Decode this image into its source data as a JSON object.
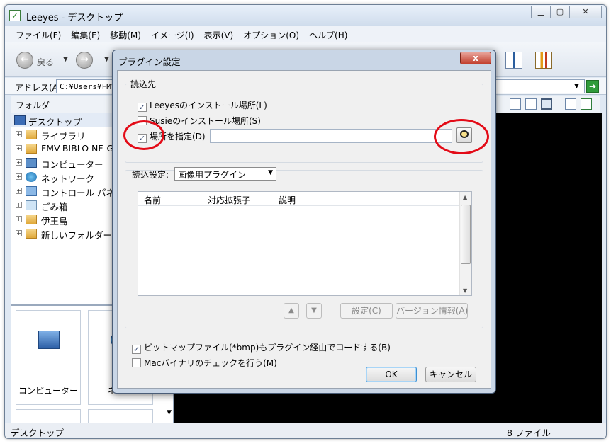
{
  "window": {
    "title": "Leeyes - デスクトップ",
    "menu": [
      "ファイル(F)",
      "編集(E)",
      "移動(M)",
      "イメージ(I)",
      "表示(V)",
      "オプション(O)",
      "ヘルプ(H)"
    ],
    "toolbar": {
      "back_label": "戻る"
    },
    "address": {
      "label": "アドレス(A)",
      "value": "C:¥Users¥FMV"
    },
    "folder_pane": {
      "header": "フォルダ",
      "items": [
        {
          "label": "デスクトップ",
          "icon": "desktop-icon"
        },
        {
          "label": "ライブラリ",
          "icon": "library-icon"
        },
        {
          "label": "FMV-BIBLO NF-G",
          "icon": "user-folder-icon"
        },
        {
          "label": "コンピューター",
          "icon": "computer-icon"
        },
        {
          "label": "ネットワーク",
          "icon": "network-icon"
        },
        {
          "label": "コントロール パネ",
          "icon": "control-panel-icon"
        },
        {
          "label": "ごみ箱",
          "icon": "recycle-bin-icon"
        },
        {
          "label": "伊王島",
          "icon": "folder-icon"
        },
        {
          "label": "新しいフォルダー",
          "icon": "folder-icon"
        }
      ]
    },
    "thumbnails": [
      {
        "label": "コンピューター"
      },
      {
        "label": "ネット"
      }
    ],
    "status": {
      "left": "デスクトップ",
      "right": "8 ファイル"
    }
  },
  "dialog": {
    "title": "プラグイン設定",
    "close_label": "x",
    "group_read_location": "読込先",
    "opt_install_location": "Leeyesのインストール場所(L)",
    "opt_susie_location": "Susieのインストール場所(S)",
    "opt_specify_location": "場所を指定(D)",
    "path_value": "",
    "read_settings_label": "読込設定:",
    "read_settings_value": "画像用プラグイン",
    "columns": [
      "名前",
      "対応拡張子",
      "説明"
    ],
    "btn_settings": "設定(C)",
    "btn_version": "バージョン情報(A)",
    "opt_bitmap_via_plugin": "ビットマップファイル(*bmp)もプラグイン経由でロードする(B)",
    "opt_mac_binary": "Macバイナリのチェックを行う(M)",
    "btn_ok": "OK",
    "btn_cancel": "キャンセル",
    "checked": {
      "install_location": true,
      "susie_location": false,
      "specify_location": true,
      "bitmap_via_plugin": true,
      "mac_binary": false
    },
    "highlight_color": "#e30b17"
  }
}
